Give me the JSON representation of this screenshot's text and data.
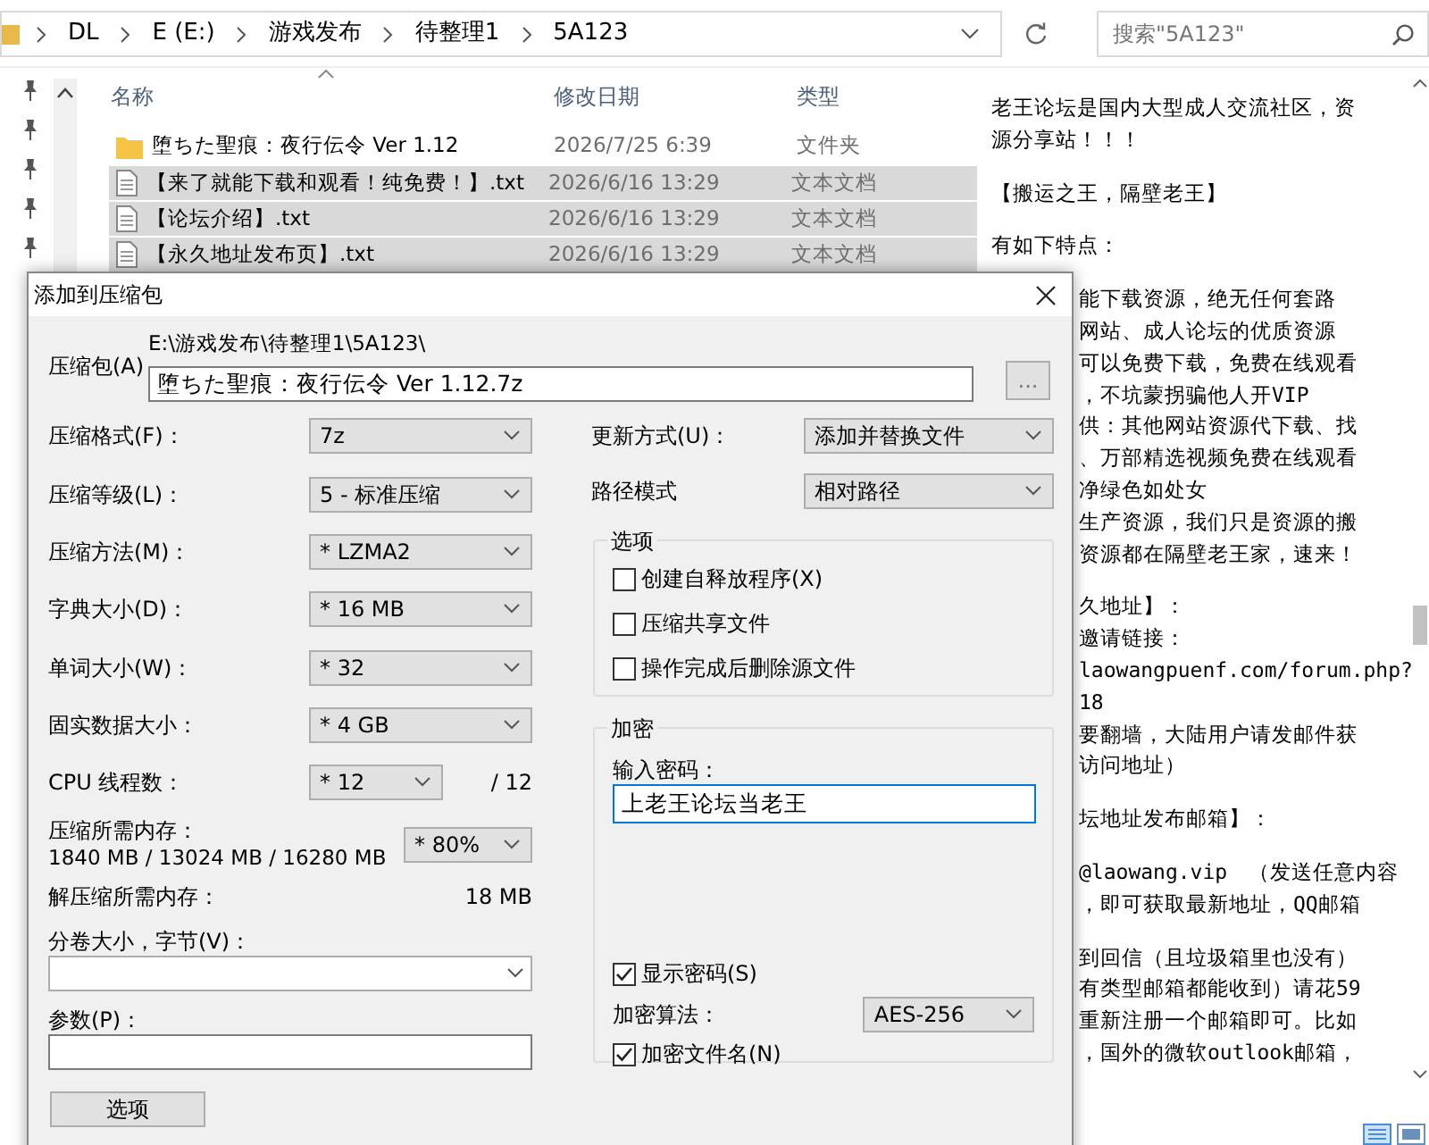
{
  "address_bar": {
    "crumbs": [
      "DL",
      "E (E:)",
      "游戏发布",
      "待整理1",
      "5A123"
    ],
    "search": {
      "placeholder": "搜索\"5A123\""
    }
  },
  "file_list": {
    "columns": [
      "名称",
      "修改日期",
      "类型"
    ],
    "rows": [
      {
        "kind": "folder",
        "name": "堕ちた聖痕：夜行伝令 Ver 1.12",
        "modified": "2026/7/25 6:39",
        "type": "文件夹",
        "selected": false
      },
      {
        "kind": "text",
        "name": "【来了就能下载和观看！纯免费！】.txt",
        "modified": "2026/6/16 13:29",
        "type": "文本文档",
        "selected": true
      },
      {
        "kind": "text",
        "name": "【论坛介绍】.txt",
        "modified": "2026/6/16 13:29",
        "type": "文本文档",
        "selected": true
      },
      {
        "kind": "text",
        "name": "【永久地址发布页】.txt",
        "modified": "2026/6/16 13:29",
        "type": "文本文档",
        "selected": true
      }
    ]
  },
  "preview": {
    "paragraphs": [
      {
        "kind": "full",
        "lines": [
          "老王论坛是国内大型成人交流社区，资",
          "源分享站！！！"
        ]
      },
      {
        "kind": "full",
        "lines": [
          "【搬运之王，隔壁老王】"
        ]
      },
      {
        "kind": "full",
        "lines": [
          "有如下特点："
        ]
      },
      {
        "kind": "cut",
        "lines": [
          "能下载资源，绝无任何套路",
          "网站、成人论坛的优质资源",
          "可以免费下载，免费在线观看",
          "，不坑蒙拐骗他人开VIP",
          "供：其他网站资源代下载、找",
          "、万部精选视频免费在线观看",
          "净绿色如处女",
          "生产资源，我们只是资源的搬",
          "资源都在隔壁老王家，速来！"
        ]
      },
      {
        "kind": "cut",
        "lines": [
          "久地址】：",
          "邀请链接：",
          "laowangpuenf.com/forum.php?",
          "18",
          "要翻墙，大陆用户请发邮件获",
          "访问地址）"
        ]
      },
      {
        "kind": "cut",
        "lines": [
          "坛地址发布邮箱】："
        ]
      },
      {
        "kind": "cut",
        "lines": [
          "@laowang.vip　（发送任意内容",
          "，即可获取最新地址，QQ邮箱"
        ]
      },
      {
        "kind": "cut",
        "lines": [
          "到回信（且垃圾箱里也没有）",
          "有类型邮箱都能收到）请花59",
          "重新注册一个邮箱即可。比如",
          "，国外的微软outlook邮箱，"
        ]
      }
    ]
  },
  "dialog": {
    "title": "添加到压缩包",
    "archive": {
      "label": "压缩包(A)",
      "folder": "E:\\游戏发布\\待整理1\\5A123\\",
      "value": "堕ちた聖痕：夜行伝令 Ver 1.12.7z",
      "browse": "..."
    },
    "settings": [
      {
        "label": "压缩格式(F)：",
        "value": "7z"
      },
      {
        "label": "压缩等级(L)：",
        "value": "5 - 标准压缩"
      },
      {
        "label": "压缩方法(M)：",
        "value": "* LZMA2"
      },
      {
        "label": "字典大小(D)：",
        "value": "* 16 MB"
      },
      {
        "label": "单词大小(W)：",
        "value": "* 32"
      },
      {
        "label": "固实数据大小：",
        "value": "* 4 GB"
      }
    ],
    "threads": {
      "label": "CPU 线程数：",
      "value": "* 12",
      "max": "/ 12"
    },
    "memory": {
      "label": "压缩所需内存：",
      "detail": "1840 MB / 13024 MB / 16280 MB",
      "value": "* 80%"
    },
    "decompress_memory": {
      "label": "解压缩所需内存：",
      "value": "18 MB"
    },
    "volume": {
      "label": "分卷大小，字节(V)："
    },
    "parameters": {
      "label": "参数(P)："
    },
    "options_button": "选项",
    "update_mode": {
      "label": "更新方式(U)：",
      "value": "添加并替换文件"
    },
    "path_mode": {
      "label": "路径模式",
      "value": "相对路径"
    },
    "options_group": {
      "title": "选项",
      "checkboxes": [
        {
          "label": "创建自释放程序(X)",
          "checked": false
        },
        {
          "label": "压缩共享文件",
          "checked": false
        },
        {
          "label": "操作完成后删除源文件",
          "checked": false
        }
      ]
    },
    "encryption": {
      "title": "加密",
      "password_label": "输入密码：",
      "password": "上老王论坛当老王",
      "show_password": {
        "label": "显示密码(S)",
        "checked": true
      },
      "method": {
        "label": "加密算法：",
        "value": "AES-256"
      },
      "encrypt_names": {
        "label": "加密文件名(N)",
        "checked": true
      }
    }
  }
}
